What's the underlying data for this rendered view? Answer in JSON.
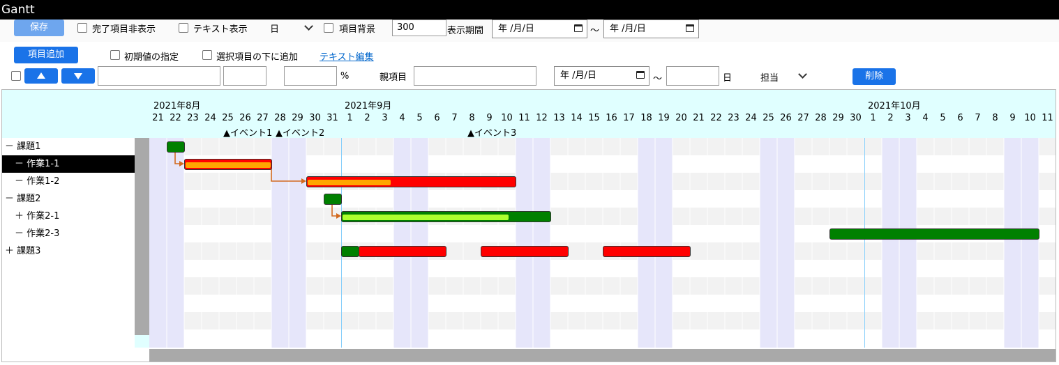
{
  "app": {
    "title": "Gantt"
  },
  "toolbar1": {
    "save_label": "保存",
    "hide_completed_label": "完了項目非表示",
    "text_display_label": "テキスト表示",
    "scale_select_value": "日",
    "item_bg_label": "項目背景",
    "width_value": "300",
    "period_label": "表示期間",
    "period_from": "年 /月/日",
    "tilde": "～",
    "period_to": "年 /月/日"
  },
  "toolbar2": {
    "add_item_label": "項目追加",
    "initial_value_label": "初期値の指定",
    "add_below_label": "選択項目の下に追加",
    "text_edit_link": "テキスト編集"
  },
  "toolbar3": {
    "name_value": "",
    "short_value": "",
    "percent_value": "",
    "percent_label": "%",
    "parent_label": "親項目",
    "parent_value": "",
    "start_date": "年 /月/日",
    "tilde": "～",
    "days_value": "",
    "days_label": "日",
    "assignee_label": "担当",
    "delete_label": "削除"
  },
  "gantt": {
    "months": [
      "2021年8月",
      "2021年9月",
      "2021年10月"
    ],
    "days": [
      "21",
      "22",
      "23",
      "24",
      "25",
      "26",
      "27",
      "28",
      "29",
      "30",
      "31",
      "1",
      "2",
      "3",
      "4",
      "5",
      "6",
      "7",
      "8",
      "9",
      "10",
      "11",
      "12",
      "13",
      "14",
      "15",
      "16",
      "17",
      "18",
      "19",
      "20",
      "21",
      "22",
      "23",
      "24",
      "25",
      "26",
      "27",
      "28",
      "29",
      "30",
      "1",
      "2",
      "3",
      "4",
      "5",
      "6",
      "7",
      "8",
      "9",
      "10",
      "11"
    ],
    "events": [
      {
        "label": "▲イベント1",
        "day_index": 4
      },
      {
        "label": "▲イベント2",
        "day_index": 7
      },
      {
        "label": "▲イベント3",
        "day_index": 18
      }
    ],
    "tasks": [
      {
        "label": "－ 課題1",
        "indent": 0
      },
      {
        "label": "－ 作業1-1",
        "indent": 1,
        "selected": true
      },
      {
        "label": "－ 作業1-2",
        "indent": 1
      },
      {
        "label": "－ 課題2",
        "indent": 0
      },
      {
        "label": "＋ 作業2-1",
        "indent": 1
      },
      {
        "label": "－ 作業2-3",
        "indent": 1
      },
      {
        "label": "＋ 課題3",
        "indent": 0
      }
    ],
    "colors": {
      "green": "#008000",
      "red": "#ff0000",
      "orange": "#ffa500",
      "lime": "#adff2f",
      "weekend": "#e6e6fa",
      "arrow": "#d2691e",
      "header_bg": "#e0ffff"
    },
    "bars": [
      {
        "row": 0,
        "start": 1,
        "days": 1,
        "color": "green"
      },
      {
        "row": 1,
        "start": 2,
        "days": 5,
        "color": "red",
        "progress": 1.0,
        "progress_color": "orange"
      },
      {
        "row": 2,
        "start": 9,
        "days": 12,
        "color": "red",
        "progress": 0.4,
        "progress_color": "orange"
      },
      {
        "row": 3,
        "start": 10,
        "days": 1,
        "color": "green"
      },
      {
        "row": 4,
        "start": 11,
        "days": 12,
        "color": "green",
        "progress": 0.8,
        "progress_color": "lime"
      },
      {
        "row": 5,
        "start": 39,
        "days": 12,
        "color": "green"
      },
      {
        "row": 6,
        "start": 11,
        "days": 1,
        "color": "green"
      },
      {
        "row": 6,
        "start": 12,
        "days": 5,
        "color": "red"
      },
      {
        "row": 6,
        "start": 19,
        "days": 5,
        "color": "red"
      },
      {
        "row": 6,
        "start": 26,
        "days": 5,
        "color": "red"
      }
    ],
    "dependencies": [
      {
        "from_row": 0,
        "from_day": 1,
        "to_row": 1,
        "to_day": 2
      },
      {
        "from_row": 1,
        "from_day": 7,
        "to_row": 2,
        "to_day": 9
      },
      {
        "from_row": 3,
        "from_day": 10,
        "to_row": 4,
        "to_day": 11
      }
    ],
    "weekend_starts": [
      0,
      7,
      14,
      21,
      28,
      35,
      42,
      49
    ],
    "month_start_days": [
      11,
      41
    ]
  }
}
